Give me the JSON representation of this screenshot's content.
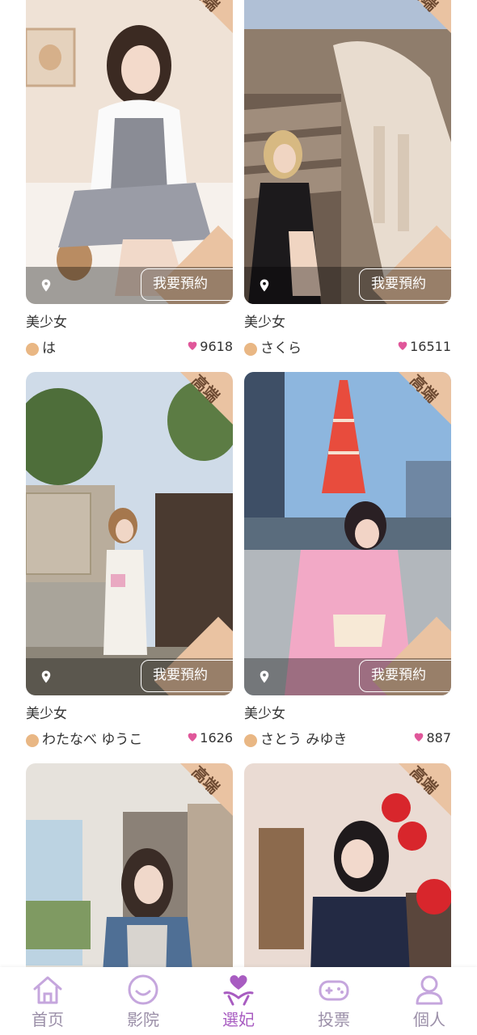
{
  "cards": [
    {
      "badge": "高端",
      "button_label": "我要預約",
      "title": "美少女",
      "name": "は",
      "likes": "9618"
    },
    {
      "badge": "高端",
      "button_label": "我要預約",
      "title": "美少女",
      "name": "さくら",
      "likes": "16511"
    },
    {
      "badge": "高端",
      "button_label": "我要預約",
      "title": "美少女",
      "name": "わたなべ ゆうこ",
      "likes": "1626"
    },
    {
      "badge": "高端",
      "button_label": "我要預約",
      "title": "美少女",
      "name": "さとう みゆき",
      "likes": "887"
    },
    {
      "badge": "高端"
    },
    {
      "badge": "高端"
    }
  ],
  "tabbar": {
    "items": [
      {
        "label": "首页",
        "icon": "home-icon",
        "active": false
      },
      {
        "label": "影院",
        "icon": "smile-icon",
        "active": false
      },
      {
        "label": "選妃",
        "icon": "select-consort-icon",
        "active": true
      },
      {
        "label": "投票",
        "icon": "gamepad-icon",
        "active": false
      },
      {
        "label": "個人",
        "icon": "person-icon",
        "active": false
      }
    ]
  },
  "colors": {
    "accent": "#a85cc1",
    "tab_inactive": "#c5a6dd",
    "badge_bg": "#eac3a2",
    "heart": "#e0579a",
    "name_dot": "#e9b784"
  }
}
